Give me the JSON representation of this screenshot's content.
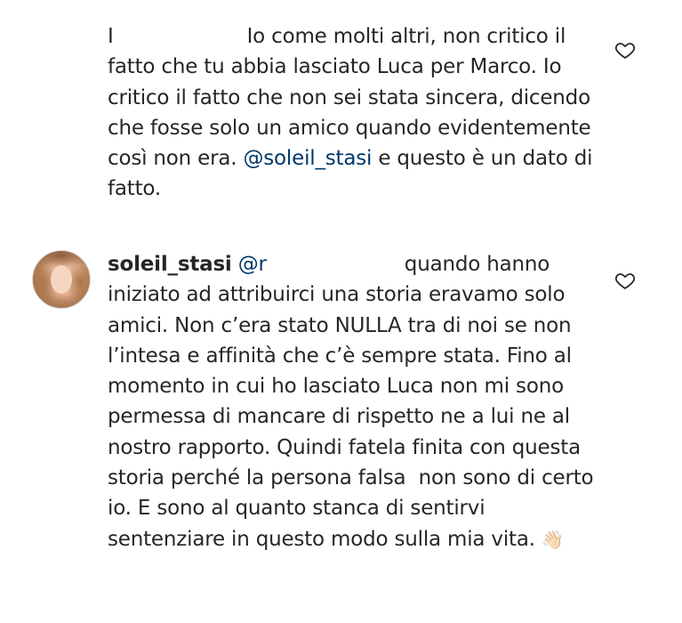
{
  "comments": [
    {
      "prefix": "I",
      "text_after_redaction": "Io come molti altri, non critico il fatto che tu abbia lasciato Luca per Marco. Io critico il fatto che non sei stata sincera, dicendo che fosse solo un amico quando evidentemente così non era. ",
      "mention": "@soleil_stasi",
      "text_after_mention": " e questo è un dato di fatto.",
      "like_icon": "heart-outline-icon"
    },
    {
      "username": "soleil_stasi",
      "mention_prefix": " @r",
      "text_after_redaction": "quando hanno iniziato ad attribuirci una storia eravamo solo amici. Non c’era stato NULLA tra di noi se non l’intesa e affinità che c’è sempre stata. Fino al momento in cui ho lasciato Luca non mi sono permessa di mancare di rispetto ne a lui ne al nostro rapporto. Quindi fatela finita con questa storia perché la persona falsa  non sono di certo io. E sono al quanto stanca di sentirvi sentenziare in questo modo sulla mia vita. ",
      "emoji": "👋🏻",
      "like_icon": "heart-outline-icon"
    }
  ]
}
